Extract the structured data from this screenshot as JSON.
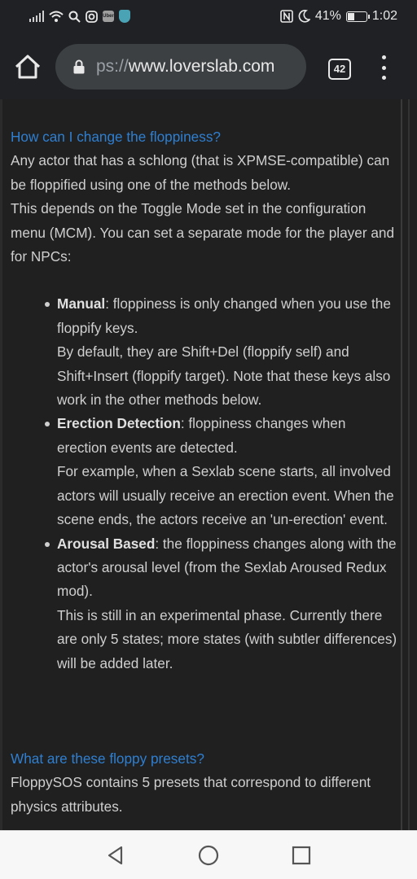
{
  "status_bar": {
    "battery_percent": "41%",
    "time": "1:02",
    "battery_level": 0.41,
    "icons_left": [
      "signal-icon",
      "wifi-icon",
      "search-icon",
      "instagram-icon",
      "uber-eats-icon",
      "vpn-shield-icon"
    ],
    "icons_right": [
      "nfc-icon",
      "do-not-disturb-moon-icon",
      "battery-icon"
    ],
    "uber_label": "Uber"
  },
  "browser": {
    "url_scheme": "ps://",
    "url_host": "www.loverslab.com",
    "tab_count": "42"
  },
  "article": {
    "section1": {
      "heading": "How can I change the floppiness?",
      "intro1": "Any actor that has a schlong (that is XPMSE-compatible) can be floppified using one of the methods below.",
      "intro2": "This depends on the Toggle Mode set in the configuration menu (MCM). You can set a separate mode for the player and for NPCs:",
      "items": [
        {
          "term": "Manual",
          "desc": ": floppiness is only changed when you use the floppify keys.",
          "extra": "By default, they are Shift+Del (floppify self) and Shift+Insert (floppify target). Note that these keys also work in the other methods below."
        },
        {
          "term": "Erection Detection",
          "desc": ": floppiness changes when erection events are detected.",
          "extra": "For example, when a Sexlab scene starts, all involved actors will usually receive an erection event. When the scene ends, the actors receive an 'un-erection' event."
        },
        {
          "term": "Arousal Based",
          "desc": ": the floppiness changes along with the actor's arousal level (from the Sexlab Aroused Redux mod).",
          "extra": "This is still in an experimental phase. Currently there are only 5 states; more states (with subtler differences) will be added later."
        }
      ]
    },
    "section2": {
      "heading": "What are these floppy presets?",
      "intro": "FloppySOS contains 5 presets that correspond to different physics attributes."
    }
  },
  "colors": {
    "link_heading": "#2f7fd1",
    "page_bg": "#202020",
    "toolbar_bg": "#202124",
    "urlbar_bg": "#3c4043"
  }
}
